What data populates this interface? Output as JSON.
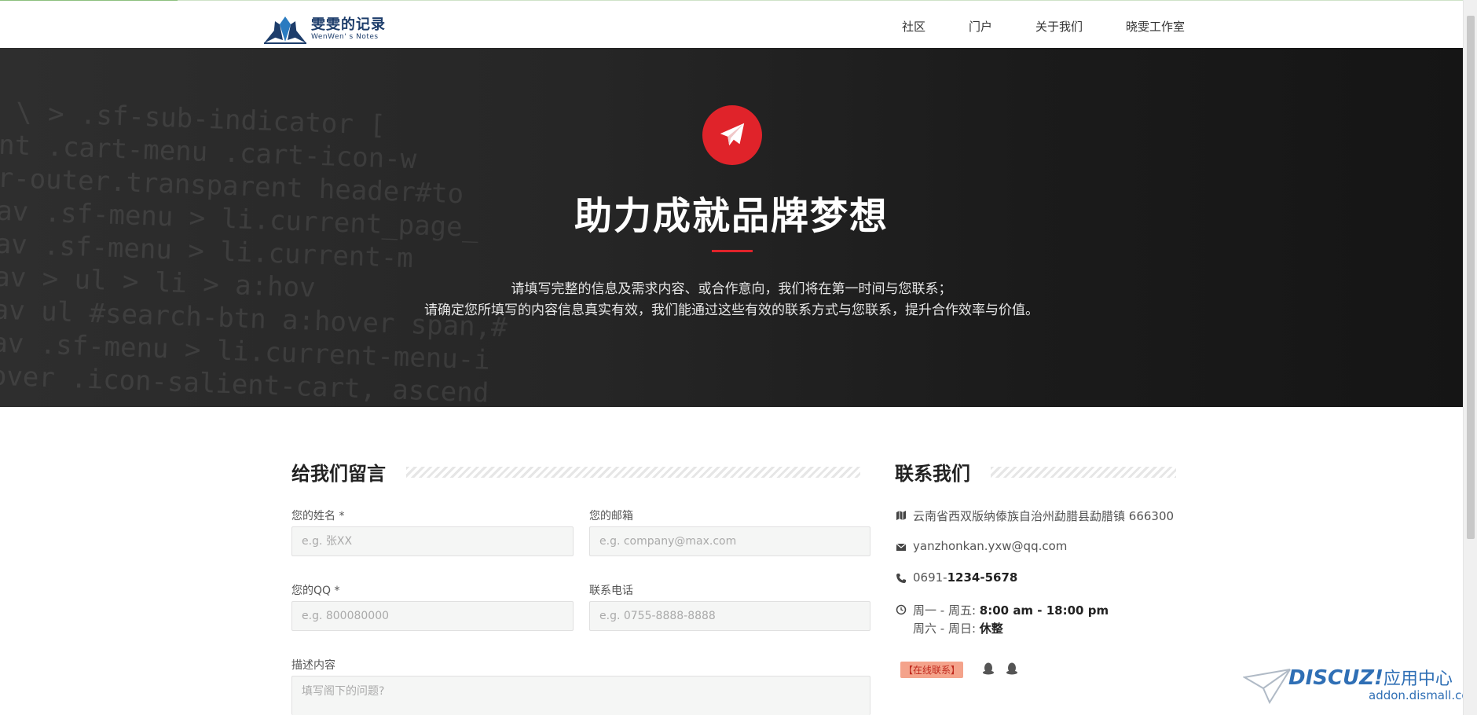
{
  "header": {
    "logo_cn": "雯雯的记录",
    "logo_en": "WenWen' s Notes",
    "nav": [
      "社区",
      "门户",
      "关于我们",
      "晓雯工作室"
    ]
  },
  "hero": {
    "title": "助力成就品牌梦想",
    "desc_line1": "请填写完整的信息及需求内容、或合作意向，我们将在第一时间与您联系；",
    "desc_line2": "请确定您所填写的内容信息真实有效，我们能通过这些有效的联系方式与您联系，提升合作效率与价值。",
    "code_lines": [
      "  \\ > .sf-sub-indicator [",
      "ent .cart-menu .cart-icon-w",
      "er-outer.transparent header#to",
      "nav .sf-menu > li.current_page_",
      "nav .sf-menu > li.current-m",
      "nav > ul > li > a:hov",
      "nav ul #search-btn a:hover span,#",
      "nav .sf-menu > li.current-menu-i",
      "hover .icon-salient-cart, ascend"
    ],
    "accent": "#e0232a"
  },
  "form": {
    "title": "给我们留言",
    "name_label": "您的姓名 *",
    "name_placeholder": "e.g. 张XX",
    "email_label": "您的邮箱",
    "email_placeholder": "e.g. company@max.com",
    "qq_label": "您的QQ *",
    "qq_placeholder": "e.g. 800080000",
    "phone_label": "联系电话",
    "phone_placeholder": "e.g. 0755-8888-8888",
    "desc_label": "描述内容",
    "desc_placeholder": "填写阁下的问题?"
  },
  "contact": {
    "title": "联系我们",
    "address": "云南省西双版纳傣族自治州勐腊县勐腊镇 666300",
    "email": "yanzhonkan.yxw@qq.com",
    "phone_prefix": "0691-",
    "phone_main": "1234-5678",
    "hours1_label": "周一 - 周五: ",
    "hours1_value": "8:00 am - 18:00 pm",
    "hours2_label": "周六 - 周日: ",
    "hours2_value": "休整",
    "online": "【在线联系】"
  },
  "watermark": {
    "brand": "DISCUZ!",
    "cn": "应用中心",
    "url": "addon.dismall.com"
  }
}
